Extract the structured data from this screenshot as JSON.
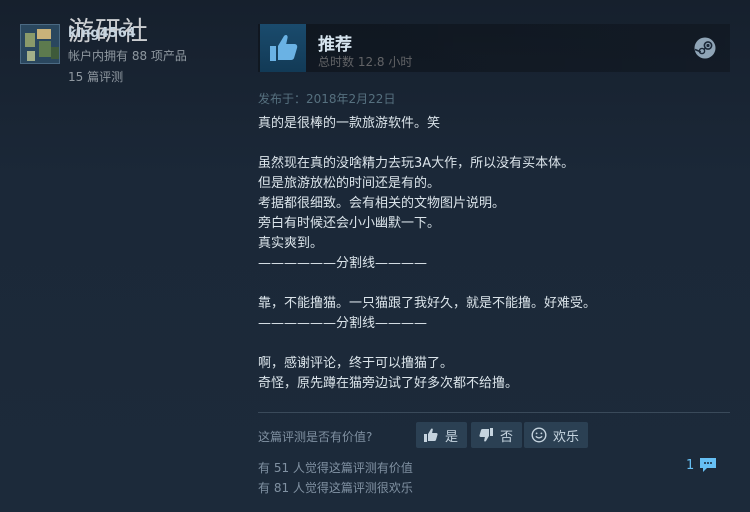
{
  "watermark": "游研社",
  "author": {
    "name": "king4564",
    "products": "帐户内拥有 88 项产品",
    "reviews": "15 篇评测"
  },
  "review": {
    "verdict": "推荐",
    "hours": "总时数 12.8 小时",
    "posted": "发布于：2018年2月22日",
    "lines": [
      "真的是很棒的一款旅游软件。笑",
      "",
      "虽然现在真的没啥精力去玩3A大作，所以没有买本体。",
      "但是旅游放松的时间还是有的。",
      "考据都很细致。会有相关的文物图片说明。",
      "旁白有时候还会小小幽默一下。",
      "真实爽到。",
      "——————分割线————",
      "",
      "靠，不能撸猫。一只猫跟了我好久，就是不能撸。好难受。",
      "——————分割线————",
      "",
      "啊，感谢评论，终于可以撸猫了。",
      "奇怪，原先蹲在猫旁边试了好多次都不给撸。"
    ]
  },
  "feedback": {
    "question": "这篇评测是否有价值?",
    "yes_label": "是",
    "no_label": "否",
    "funny_label": "欢乐",
    "helpful_count": "有 51 人觉得这篇评测有价值",
    "funny_count": "有 81 人觉得这篇评测很欢乐",
    "comment_count": "1"
  },
  "colors": {
    "background": "#1b2838",
    "accent": "#66c0f4",
    "thumb_bg": "#1a4b6d"
  },
  "icons": {
    "thumbs_up": "thumbs-up-icon",
    "thumbs_down": "thumbs-down-icon",
    "smile": "smile-icon",
    "steam": "steam-logo-icon",
    "comment": "comment-icon"
  }
}
